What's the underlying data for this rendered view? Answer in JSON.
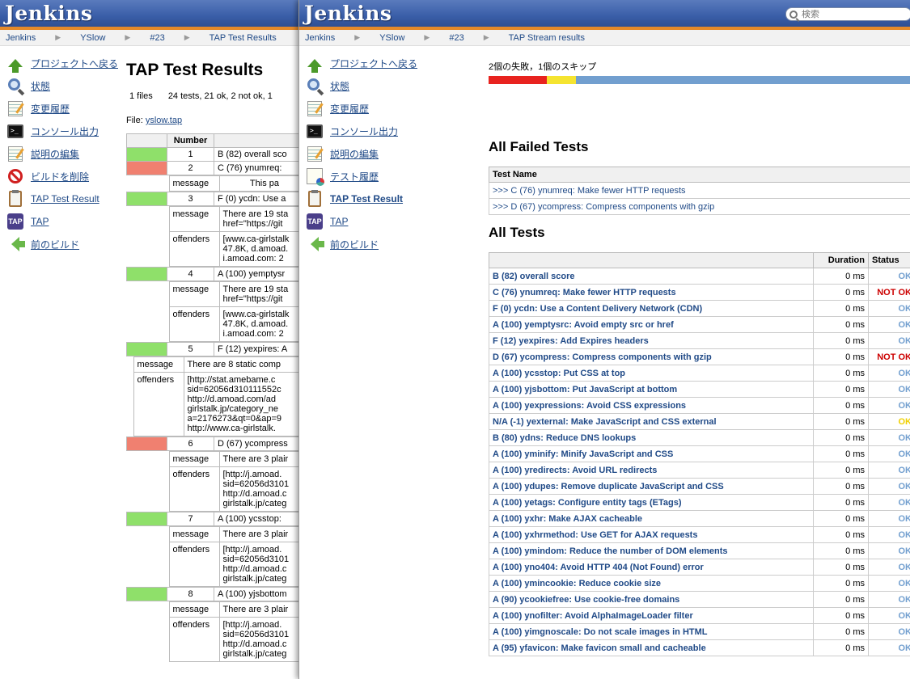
{
  "app_title": "Jenkins",
  "search": {
    "placeholder": "検索"
  },
  "back_window": {
    "breadcrumb": [
      "Jenkins",
      "YSlow",
      "#23",
      "TAP Test Results"
    ],
    "sidebar": [
      {
        "label": "プロジェクトへ戻る",
        "icon": "up-arrow-icon"
      },
      {
        "label": "状態",
        "icon": "magnifier-icon"
      },
      {
        "label": "変更履歴",
        "icon": "notepad-icon"
      },
      {
        "label": "コンソール出力",
        "icon": "terminal-icon"
      },
      {
        "label": "説明の編集",
        "icon": "notepad-icon"
      },
      {
        "label": "ビルドを削除",
        "icon": "no-entry-icon"
      },
      {
        "label": "TAP Test Result",
        "icon": "clipboard-icon"
      },
      {
        "label": "TAP",
        "icon": "tap-icon"
      },
      {
        "label": "前のビルド",
        "icon": "back-arrow-icon"
      }
    ],
    "title": "TAP Test Results",
    "summary": {
      "files": "1 files",
      "tests": "24 tests, 21 ok, 2 not ok, 1"
    },
    "file_label": "File:",
    "file_link": "yslow.tap",
    "table_header": {
      "status": "",
      "number": "Number",
      "desc": ""
    },
    "rows": [
      {
        "status": "ok",
        "number": "1",
        "desc": "B (82) overall sco"
      },
      {
        "status": "fail",
        "number": "2",
        "desc": "C (76) ynumreq:"
      },
      {
        "status": "sub",
        "k1": "message",
        "v1": "           This pa"
      },
      {
        "status": "ok",
        "number": "3",
        "desc": "F (0) ycdn: Use a"
      },
      {
        "status": "sub2",
        "k1": "message",
        "v1": "There are 19 sta\nhref=\"https://git",
        "k2": "offenders",
        "v2": "[www.ca-girlstalk\n47.8K, d.amoad.\ni.amoad.com: 2"
      },
      {
        "status": "ok",
        "number": "4",
        "desc": "A (100) yemptysr"
      },
      {
        "status": "sub2",
        "k1": "message",
        "v1": "There are 19 sta\nhref=\"https://git",
        "k2": "offenders",
        "v2": "[www.ca-girlstalk\n47.8K, d.amoad.\ni.amoad.com: 2"
      },
      {
        "status": "ok",
        "number": "5",
        "desc": "F (12) yexpires: A"
      },
      {
        "status": "sub2w",
        "k1": "message",
        "v1": "There are 8 static comp",
        "k2": "offenders",
        "v2": "[http://stat.amebame.c\nsid=62056d310111552c\nhttp://d.amoad.com/ad\ngirlstalk.jp/category_ne\na=2176273&qt=0&ap=9\nhttp://www.ca-girlstalk."
      },
      {
        "status": "fail",
        "number": "6",
        "desc": "D (67) ycompress"
      },
      {
        "status": "sub2",
        "k1": "message",
        "v1": "There are 3 plair",
        "k2": "offenders",
        "v2": "[http://j.amoad.\nsid=62056d3101\nhttp://d.amoad.c\ngirlstalk.jp/categ"
      },
      {
        "status": "ok",
        "number": "7",
        "desc": "A (100) ycsstop:"
      },
      {
        "status": "sub2",
        "k1": "message",
        "v1": "There are 3 plair",
        "k2": "offenders",
        "v2": "[http://j.amoad.\nsid=62056d3101\nhttp://d.amoad.c\ngirlstalk.jp/categ"
      },
      {
        "status": "ok",
        "number": "8",
        "desc": "A (100) yjsbottom"
      },
      {
        "status": "sub2",
        "k1": "message",
        "v1": "There are 3 plair",
        "k2": "offenders",
        "v2": "[http://j.amoad.\nsid=62056d3101\nhttp://d.amoad.c\ngirlstalk.jp/categ"
      }
    ]
  },
  "front_window": {
    "breadcrumb": [
      "Jenkins",
      "YSlow",
      "#23",
      "TAP Stream results"
    ],
    "sidebar": [
      {
        "label": "プロジェクトへ戻る",
        "icon": "up-arrow-icon"
      },
      {
        "label": "状態",
        "icon": "magnifier-icon"
      },
      {
        "label": "変更履歴",
        "icon": "notepad-icon"
      },
      {
        "label": "コンソール出力",
        "icon": "terminal-icon"
      },
      {
        "label": "説明の編集",
        "icon": "notepad-icon"
      },
      {
        "label": "テスト履歴",
        "icon": "history-icon"
      },
      {
        "label": "TAP Test Result",
        "icon": "clipboard-icon",
        "active": true
      },
      {
        "label": "TAP",
        "icon": "tap-icon"
      },
      {
        "label": "前のビルド",
        "icon": "back-arrow-icon"
      }
    ],
    "fail_summary": "2個の失敗，1個のスキップ",
    "progress": {
      "fail": 0.135,
      "skip": 0.068,
      "pass": 0.797,
      "fail_color": "#e8231f",
      "skip_color": "#f5e430",
      "pass_color": "#729fcf"
    },
    "failed_title": "All Failed Tests",
    "failed_header": "Test Name",
    "failed_tests": [
      ">>> C (76) ynumreq: Make fewer HTTP requests",
      ">>> D (67) ycompress: Compress components with gzip"
    ],
    "all_title": "All Tests",
    "all_header": {
      "name": "",
      "duration": "Duration",
      "status": "Status"
    },
    "status_colors": {
      "OK": "#729fcf",
      "NOT OK": "#cc0000",
      "SKIP": "#f0d000"
    },
    "all_tests": [
      {
        "name": "B (82) overall score",
        "duration": "0 ms",
        "status": "OK"
      },
      {
        "name": "C (76) ynumreq: Make fewer HTTP requests",
        "duration": "0 ms",
        "status": "NOT OK"
      },
      {
        "name": "F (0) ycdn: Use a Content Delivery Network (CDN)",
        "duration": "0 ms",
        "status": "OK"
      },
      {
        "name": "A (100) yemptysrc: Avoid empty src or href",
        "duration": "0 ms",
        "status": "OK"
      },
      {
        "name": "F (12) yexpires: Add Expires headers",
        "duration": "0 ms",
        "status": "OK"
      },
      {
        "name": "D (67) ycompress: Compress components with gzip",
        "duration": "0 ms",
        "status": "NOT OK"
      },
      {
        "name": "A (100) ycsstop: Put CSS at top",
        "duration": "0 ms",
        "status": "OK"
      },
      {
        "name": "A (100) yjsbottom: Put JavaScript at bottom",
        "duration": "0 ms",
        "status": "OK"
      },
      {
        "name": "A (100) yexpressions: Avoid CSS expressions",
        "duration": "0 ms",
        "status": "OK"
      },
      {
        "name": "N/A (-1) yexternal: Make JavaScript and CSS external",
        "duration": "0 ms",
        "status": "SKIP",
        "status_text": "OK"
      },
      {
        "name": "B (80) ydns: Reduce DNS lookups",
        "duration": "0 ms",
        "status": "OK"
      },
      {
        "name": "A (100) yminify: Minify JavaScript and CSS",
        "duration": "0 ms",
        "status": "OK"
      },
      {
        "name": "A (100) yredirects: Avoid URL redirects",
        "duration": "0 ms",
        "status": "OK"
      },
      {
        "name": "A (100) ydupes: Remove duplicate JavaScript and CSS",
        "duration": "0 ms",
        "status": "OK"
      },
      {
        "name": "A (100) yetags: Configure entity tags (ETags)",
        "duration": "0 ms",
        "status": "OK"
      },
      {
        "name": "A (100) yxhr: Make AJAX cacheable",
        "duration": "0 ms",
        "status": "OK"
      },
      {
        "name": "A (100) yxhrmethod: Use GET for AJAX requests",
        "duration": "0 ms",
        "status": "OK"
      },
      {
        "name": "A (100) ymindom: Reduce the number of DOM elements",
        "duration": "0 ms",
        "status": "OK"
      },
      {
        "name": "A (100) yno404: Avoid HTTP 404 (Not Found) error",
        "duration": "0 ms",
        "status": "OK"
      },
      {
        "name": "A (100) ymincookie: Reduce cookie size",
        "duration": "0 ms",
        "status": "OK"
      },
      {
        "name": "A (90) ycookiefree: Use cookie-free domains",
        "duration": "0 ms",
        "status": "OK"
      },
      {
        "name": "A (100) ynofilter: Avoid AlphaImageLoader filter",
        "duration": "0 ms",
        "status": "OK"
      },
      {
        "name": "A (100) yimgnoscale: Do not scale images in HTML",
        "duration": "0 ms",
        "status": "OK"
      },
      {
        "name": "A (95) yfavicon: Make favicon small and cacheable",
        "duration": "0 ms",
        "status": "OK"
      }
    ]
  }
}
